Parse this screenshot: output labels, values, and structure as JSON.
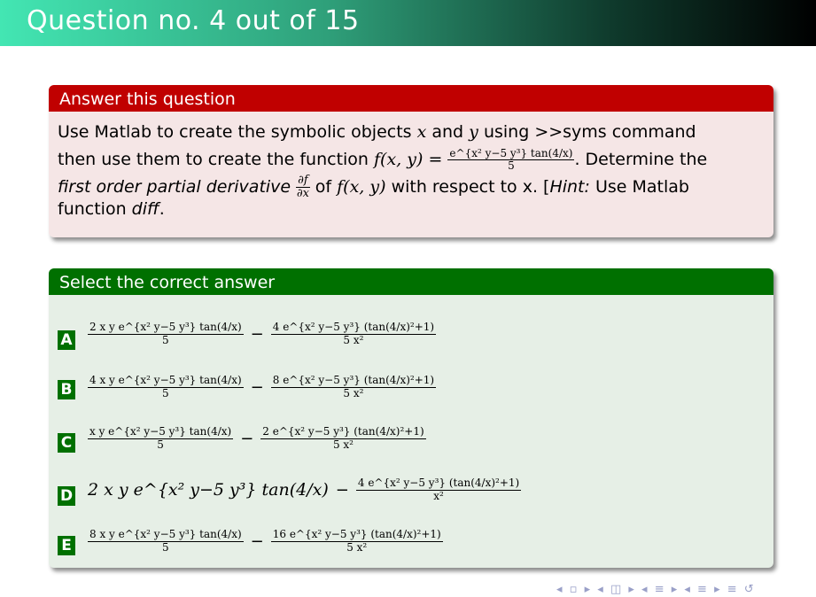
{
  "title": "Question no. 4 out of 15",
  "question": {
    "header": "Answer this question",
    "line1_a": "Use Matlab to create the symbolic objects",
    "var_x": "x",
    "and": "and",
    "var_y": "y",
    "line1_b": "using >>syms command",
    "line2_a": "then use them to create the function",
    "fxy": "f(x, y) =",
    "func_num": "e^{x² y−5 y³} tan(4/x)",
    "func_den": "5",
    "line2_b": ". Determine the",
    "line3_italic": "first order partial derivative",
    "dfdx_num": "∂f",
    "dfdx_den": "∂x",
    "line3_b": "of",
    "fxy2": "f(x, y)",
    "line3_c": "with respect to",
    "line3_d": "x. [",
    "hint_italic": "Hint:",
    "line3_e": "Use Matlab",
    "line4_a": "function",
    "diff_italic": "diff",
    "line4_b": "."
  },
  "answers": {
    "header": "Select the correct answer",
    "options": [
      {
        "label": "A",
        "t1_num": "2 x y e^{x² y−5 y³} tan(4/x)",
        "t1_den": "5",
        "op": "−",
        "t2_num": "4 e^{x² y−5 y³} (tan(4/x)²+1)",
        "t2_den": "5 x²"
      },
      {
        "label": "B",
        "t1_num": "4 x y e^{x² y−5 y³} tan(4/x)",
        "t1_den": "5",
        "op": "−",
        "t2_num": "8 e^{x² y−5 y³} (tan(4/x)²+1)",
        "t2_den": "5 x²"
      },
      {
        "label": "C",
        "t1_num": "x y e^{x² y−5 y³} tan(4/x)",
        "t1_den": "5",
        "op": "−",
        "t2_num": "2 e^{x² y−5 y³} (tan(4/x)²+1)",
        "t2_den": "5 x²"
      },
      {
        "label": "D",
        "t1_full": "2 x y e^{x² y−5 y³} tan(4/x)",
        "op": "−",
        "t2_num": "4 e^{x² y−5 y³} (tan(4/x)²+1)",
        "t2_den": "x²"
      },
      {
        "label": "E",
        "t1_num": "8 x y e^{x² y−5 y³} tan(4/x)",
        "t1_den": "5",
        "op": "−",
        "t2_num": "16 e^{x² y−5 y³} (tan(4/x)²+1)",
        "t2_den": "5 x²"
      }
    ]
  },
  "nav_icons": [
    "nav-prev-icon",
    "nav-frame-icon",
    "nav-section-icon",
    "nav-subsection-icon",
    "nav-align-icon",
    "nav-search-icon"
  ]
}
